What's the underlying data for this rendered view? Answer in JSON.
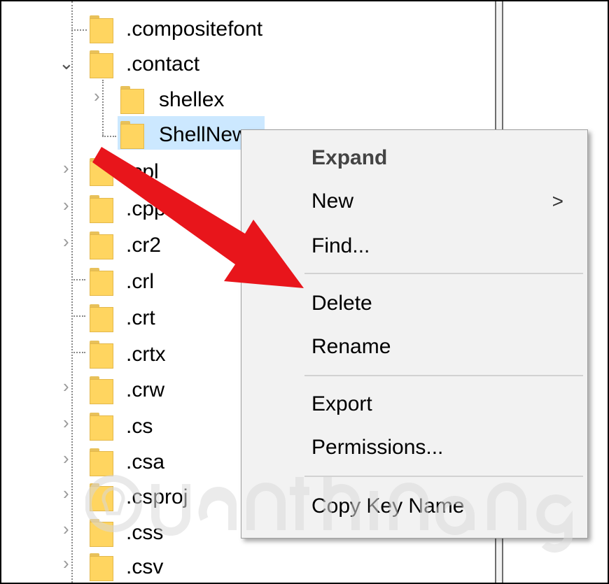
{
  "tree": {
    "items": [
      {
        "label": ".compositefont"
      },
      {
        "label": ".contact"
      },
      {
        "label": "shellex"
      },
      {
        "label": "ShellNew"
      },
      {
        "label": ".cpl"
      },
      {
        "label": ".cpp"
      },
      {
        "label": ".cr2"
      },
      {
        "label": ".crl"
      },
      {
        "label": ".crt"
      },
      {
        "label": ".crtx"
      },
      {
        "label": ".crw"
      },
      {
        "label": ".cs"
      },
      {
        "label": ".csa"
      },
      {
        "label": ".csproj"
      },
      {
        "label": ".css"
      },
      {
        "label": ".csv"
      }
    ]
  },
  "context_menu": {
    "expand": "Expand",
    "new": "New",
    "new_submenu_glyph": ">",
    "find": "Find...",
    "delete": "Delete",
    "rename": "Rename",
    "export": "Export",
    "permissions": "Permissions...",
    "copy_key_name": "Copy Key Name"
  },
  "colors": {
    "selection": "#cce8ff",
    "folder": "#ffd560",
    "arrow": "#e8151b",
    "menu_bg": "#f2f2f2"
  },
  "icons": {
    "folder": "folder-icon",
    "expand": "chevron-right-icon",
    "collapse": "chevron-down-icon",
    "watermark": "lightbulb-logo"
  }
}
